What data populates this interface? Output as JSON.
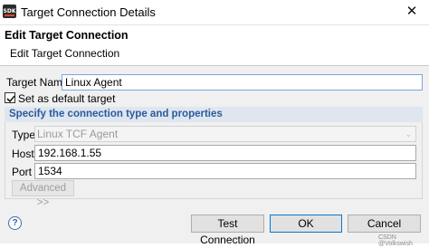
{
  "window": {
    "title": "Target Connection Details",
    "icon": "app-logo-icon",
    "close_glyph": "✕"
  },
  "header": {
    "title": "Edit Target Connection",
    "description": "Edit Target Connection"
  },
  "form": {
    "target_name_label": "Target Name",
    "target_name_value": "Linux Agent",
    "default_checkbox_label": "Set as default target",
    "default_checked": true,
    "group_title": "Specify the connection type and properties",
    "type_label": "Type",
    "type_value": "Linux TCF Agent",
    "host_label": "Host",
    "host_value": "192.168.1.55",
    "port_label": "Port",
    "port_value": "1534",
    "advanced_label": "Advanced >>"
  },
  "buttons": {
    "test_connection": "Test Connection",
    "ok": "OK",
    "cancel": "Cancel"
  },
  "help": {
    "glyph": "?"
  },
  "watermark": "CSDN @Volkswish",
  "colors": {
    "group_header_bg": "#dfe6ef",
    "group_header_text": "#2a5b9b",
    "focus_border": "#7aa7d6"
  }
}
